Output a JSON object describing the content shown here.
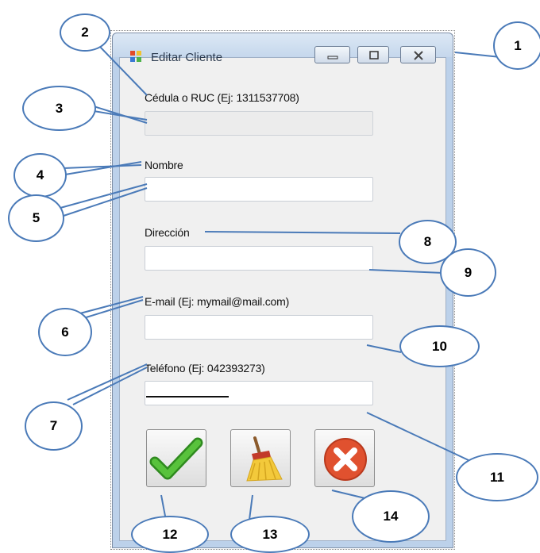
{
  "window": {
    "title": "Editar Cliente"
  },
  "form": {
    "cedula_label": "Cédula o RUC (Ej: 1311537708)",
    "cedula_value": "",
    "nombre_label": "Nombre",
    "nombre_value": "",
    "direccion_label": "Dirección",
    "direccion_value": "",
    "email_label": "E-mail (Ej: mymail@mail.com)",
    "email_value": "",
    "telefono_label": "Teléfono (Ej: 042393273)",
    "telefono_value": ""
  },
  "buttons": {
    "save_icon": "check-icon",
    "clear_icon": "broom-icon",
    "cancel_icon": "cancel-x-icon"
  },
  "callouts": [
    "1",
    "2",
    "3",
    "4",
    "5",
    "6",
    "7",
    "8",
    "9",
    "10",
    "11",
    "12",
    "13",
    "14"
  ],
  "colors": {
    "callout_border": "#4a7ab8",
    "check_green": "#3fa52b",
    "cancel_red": "#e0512f"
  }
}
